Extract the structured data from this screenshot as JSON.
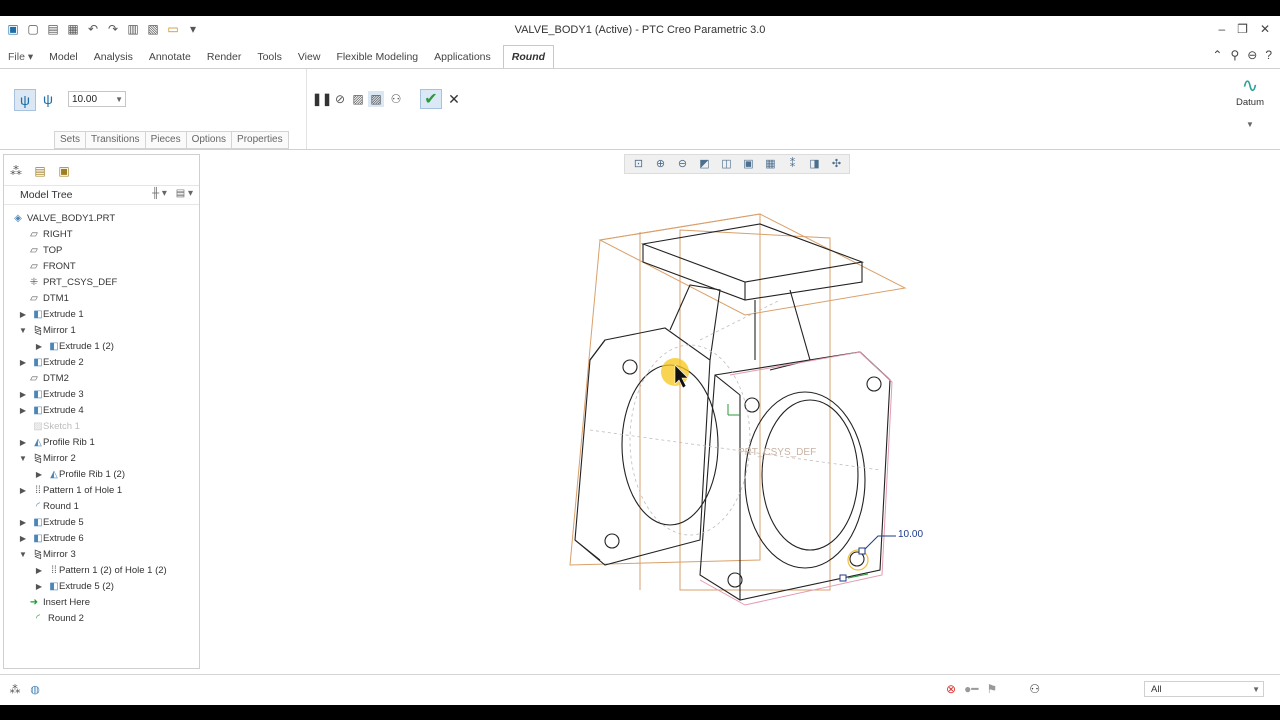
{
  "window": {
    "title": "VALVE_BODY1 (Active) - PTC Creo Parametric 3.0"
  },
  "ribbon_tabs": [
    {
      "label": "File"
    },
    {
      "label": "Model"
    },
    {
      "label": "Analysis"
    },
    {
      "label": "Annotate"
    },
    {
      "label": "Render"
    },
    {
      "label": "Tools"
    },
    {
      "label": "View"
    },
    {
      "label": "Flexible Modeling"
    },
    {
      "label": "Applications"
    },
    {
      "label": "Round"
    }
  ],
  "round": {
    "radius_value": "10.00",
    "subtabs": [
      {
        "label": "Sets"
      },
      {
        "label": "Transitions"
      },
      {
        "label": "Pieces"
      },
      {
        "label": "Options"
      },
      {
        "label": "Properties"
      }
    ],
    "datum_label": "Datum"
  },
  "model_tree": {
    "title": "Model Tree",
    "items": [
      {
        "label": "VALVE_BODY1.PRT",
        "icon": "part-icon"
      },
      {
        "label": "RIGHT",
        "icon": "datum-plane-icon"
      },
      {
        "label": "TOP",
        "icon": "datum-plane-icon"
      },
      {
        "label": "FRONT",
        "icon": "datum-plane-icon"
      },
      {
        "label": "PRT_CSYS_DEF",
        "icon": "csys-icon"
      },
      {
        "label": "DTM1",
        "icon": "datum-plane-icon"
      },
      {
        "label": "Extrude 1",
        "icon": "extrude-icon"
      },
      {
        "label": "Mirror 1",
        "icon": "mirror-icon"
      },
      {
        "label": "Extrude 1 (2)",
        "icon": "extrude-icon"
      },
      {
        "label": "Extrude 2",
        "icon": "extrude-icon"
      },
      {
        "label": "DTM2",
        "icon": "datum-plane-icon"
      },
      {
        "label": "Extrude 3",
        "icon": "extrude-icon"
      },
      {
        "label": "Extrude 4",
        "icon": "extrude-icon"
      },
      {
        "label": "Sketch 1",
        "icon": "sketch-icon"
      },
      {
        "label": "Profile Rib 1",
        "icon": "rib-icon"
      },
      {
        "label": "Mirror 2",
        "icon": "mirror-icon"
      },
      {
        "label": "Profile Rib 1 (2)",
        "icon": "rib-icon"
      },
      {
        "label": "Pattern 1 of Hole 1",
        "icon": "pattern-icon"
      },
      {
        "label": "Round 1",
        "icon": "round-icon"
      },
      {
        "label": "Extrude 5",
        "icon": "extrude-icon"
      },
      {
        "label": "Extrude 6",
        "icon": "extrude-icon"
      },
      {
        "label": "Mirror 3",
        "icon": "mirror-icon"
      },
      {
        "label": "Pattern 1 (2) of Hole 1 (2)",
        "icon": "pattern-icon"
      },
      {
        "label": "Extrude 5 (2)",
        "icon": "extrude-icon"
      },
      {
        "label": "Insert Here",
        "icon": "insert-arrow-icon"
      },
      {
        "label": "Round 2",
        "icon": "round-icon"
      }
    ]
  },
  "viewport": {
    "dimension_label": "10.00",
    "csys_label": "PRT_CSYS_DEF"
  },
  "status": {
    "filter_value": "All"
  },
  "colors": {
    "accent_blue": "#1e6ea8",
    "ok_green": "#2a9a3a",
    "datum_orange": "#d9a06b",
    "highlight_pink": "#e39bb0",
    "cursor_glow": "#f5c518"
  }
}
